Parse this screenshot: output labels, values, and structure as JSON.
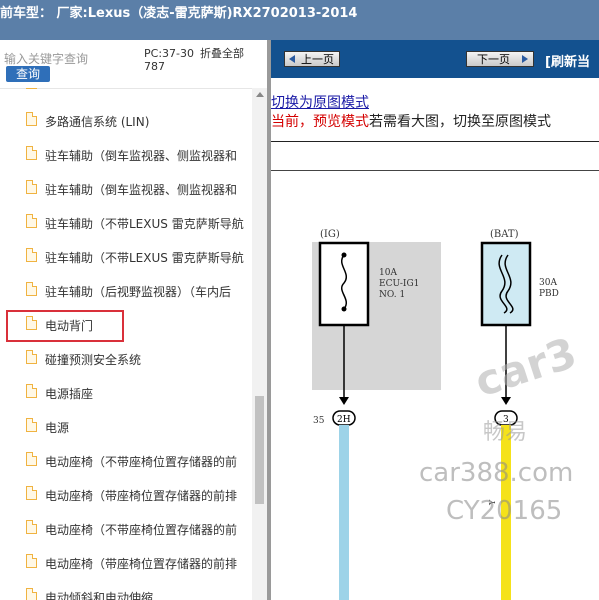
{
  "header": {
    "title": "前车型： 厂家:Lexus（凌志-雷克萨斯)RX2702013-2014"
  },
  "search": {
    "placeholder": "输入关键字查询",
    "button": "查询",
    "code": "PC:37-30787",
    "collapse": "折叠全部"
  },
  "tree": {
    "items": [
      {
        "label": "多路通信系统 (LIN)"
      },
      {
        "label": "驻车辅助（倒车监视器、侧监视器和"
      },
      {
        "label": "驻车辅助（倒车监视器、侧监视器和"
      },
      {
        "label": "驻车辅助（不带LEXUS 雷克萨斯导航"
      },
      {
        "label": "驻车辅助（不带LEXUS 雷克萨斯导航"
      },
      {
        "label": "驻车辅助（后视野监视器）（车内后"
      },
      {
        "label": "电动背门"
      },
      {
        "label": "碰撞预测安全系统"
      },
      {
        "label": "电源插座"
      },
      {
        "label": "电源"
      },
      {
        "label": "电动座椅（不带座椅位置存储器的前"
      },
      {
        "label": "电动座椅（带座椅位置存储器的前排"
      },
      {
        "label": "电动座椅（不带座椅位置存储器的前"
      },
      {
        "label": "电动座椅（带座椅位置存储器的前排"
      },
      {
        "label": "电动倾斜和电动伸缩"
      }
    ]
  },
  "nav": {
    "prev": "上一页",
    "next": "下一页",
    "refresh": "[刷新当"
  },
  "content": {
    "switch_link": "切换为原图模式",
    "mode_current": "当前，预览模式",
    "mode_hint": "若需看大图，切换至原图模式"
  },
  "diagram": {
    "ig_label": "(IG)",
    "bat_label": "(BAT)",
    "fuse1_amp": "10A",
    "fuse1_name1": "ECU-IG1",
    "fuse1_name2": "NO. 1",
    "fuse2_amp": "30A",
    "fuse2_name": "PBD",
    "pin_num": "35",
    "connector1": "2H",
    "connector2": "3",
    "wire_color": "Y",
    "watermark1": "car3",
    "watermark2": "畅易",
    "watermark3": "car388.com",
    "watermark4": "CY20165"
  },
  "colors": {
    "topbar": "#5b7fa8",
    "navbar": "#13518f",
    "accent_red": "#d40000",
    "wire_blue": "#9dd3e8",
    "wire_yellow": "#f5e21a"
  }
}
